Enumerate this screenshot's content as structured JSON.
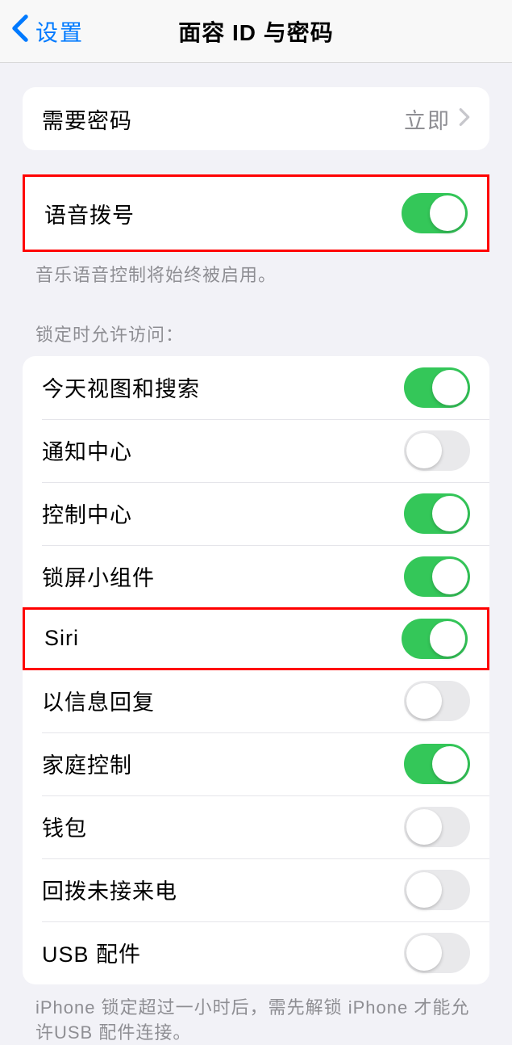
{
  "nav": {
    "back_label": "设置",
    "title": "面容 ID 与密码"
  },
  "group1": {
    "require_passcode": {
      "label": "需要密码",
      "value": "立即"
    }
  },
  "group2": {
    "voice_dial": {
      "label": "语音拨号",
      "enabled": true
    },
    "footer": "音乐语音控制将始终被启用。"
  },
  "group3": {
    "header": "锁定时允许访问：",
    "items": [
      {
        "label": "今天视图和搜索",
        "enabled": true
      },
      {
        "label": "通知中心",
        "enabled": false
      },
      {
        "label": "控制中心",
        "enabled": true
      },
      {
        "label": "锁屏小组件",
        "enabled": true
      },
      {
        "label": "Siri",
        "enabled": true
      },
      {
        "label": "以信息回复",
        "enabled": false
      },
      {
        "label": "家庭控制",
        "enabled": true
      },
      {
        "label": "钱包",
        "enabled": false
      },
      {
        "label": "回拨未接来电",
        "enabled": false
      },
      {
        "label": "USB 配件",
        "enabled": false
      }
    ],
    "footer": "iPhone 锁定超过一小时后，需先解锁 iPhone 才能允许USB 配件连接。"
  }
}
